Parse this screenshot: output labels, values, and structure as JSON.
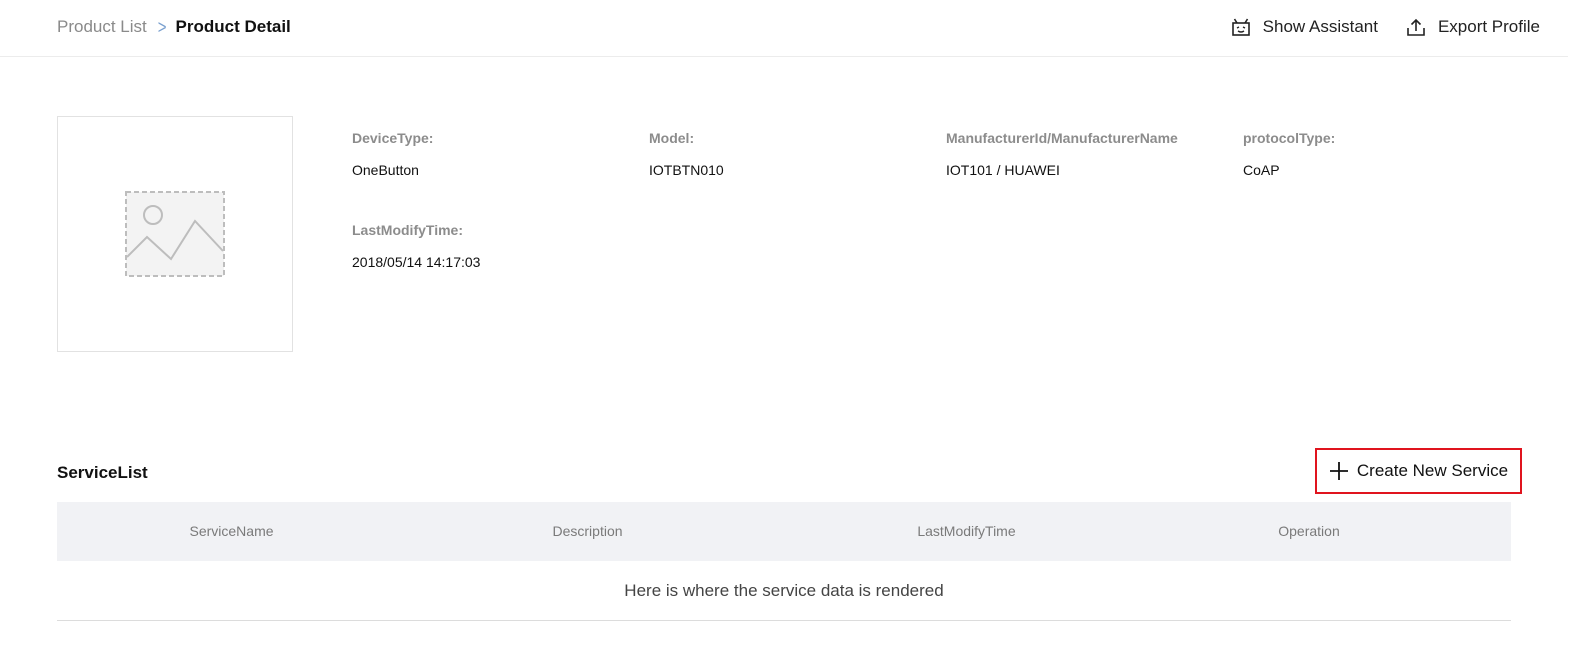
{
  "breadcrumb": {
    "parent": "Product List",
    "separator": ">",
    "current": "Product Detail"
  },
  "header_actions": {
    "show_assistant": "Show Assistant",
    "export_profile": "Export Profile"
  },
  "product": {
    "image_icon": "image-placeholder-icon",
    "fields": [
      {
        "label": "DeviceType:",
        "value": "OneButton"
      },
      {
        "label": "Model:",
        "value": "IOTBTN010"
      },
      {
        "label": "ManufacturerId/ManufacturerName",
        "value": "IOT101 / HUAWEI"
      },
      {
        "label": "protocolType:",
        "value": "CoAP"
      },
      {
        "label": "LastModifyTime:",
        "value": "2018/05/14 14:17:03"
      }
    ]
  },
  "service_list": {
    "title": "ServiceList",
    "create_button": "Create New Service",
    "columns": [
      "ServiceName",
      "Description",
      "LastModifyTime",
      "Operation"
    ],
    "empty_message": "Here is where the service data is rendered"
  },
  "colors": {
    "highlight_border": "#e0141e",
    "table_header_bg": "#f1f2f5",
    "label_gray": "#8c8c8c"
  }
}
